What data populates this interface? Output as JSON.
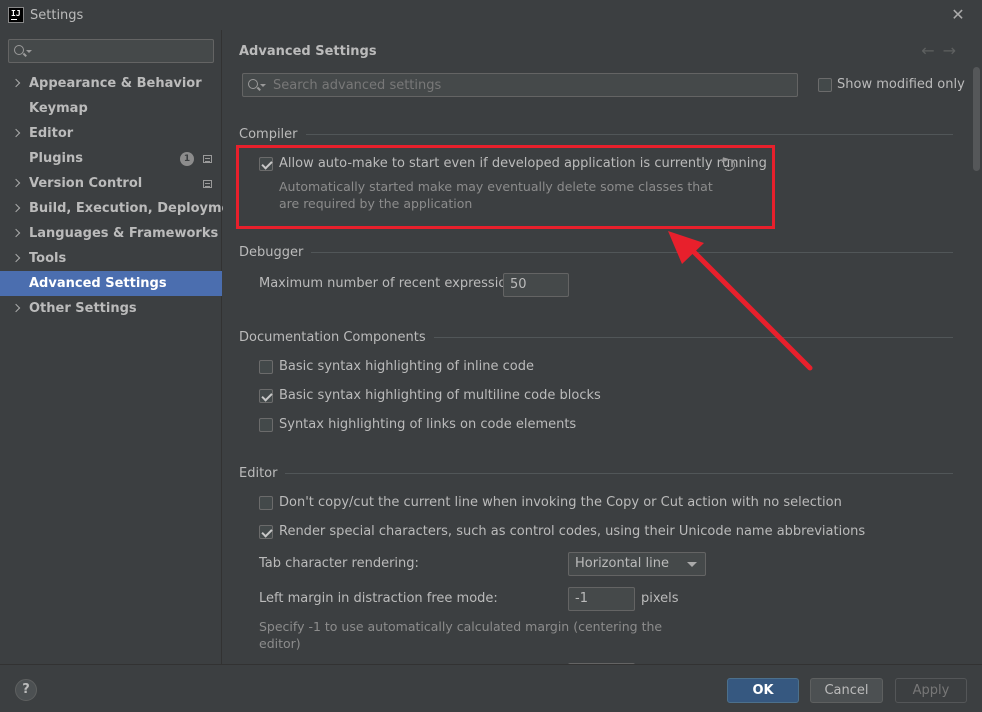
{
  "window": {
    "title": "Settings",
    "logo_text": "IJ"
  },
  "sidebar": {
    "search_placeholder": "",
    "items": [
      {
        "label": "Appearance & Behavior",
        "expandable": true
      },
      {
        "label": "Keymap",
        "expandable": false
      },
      {
        "label": "Editor",
        "expandable": true
      },
      {
        "label": "Plugins",
        "expandable": false,
        "badge": "1"
      },
      {
        "label": "Version Control",
        "expandable": true
      },
      {
        "label": "Build, Execution, Deployment",
        "expandable": true
      },
      {
        "label": "Languages & Frameworks",
        "expandable": true
      },
      {
        "label": "Tools",
        "expandable": true
      },
      {
        "label": "Advanced Settings",
        "expandable": false,
        "selected": true
      },
      {
        "label": "Other Settings",
        "expandable": true
      }
    ]
  },
  "main": {
    "title": "Advanced Settings",
    "search_placeholder": "Search advanced settings",
    "show_modified_label": "Show modified only",
    "compiler": {
      "heading": "Compiler",
      "auto_make_label": "Allow auto-make to start even if developed application is currently running",
      "auto_make_desc_1": "Automatically started make may eventually delete some classes that",
      "auto_make_desc_2": "are required by the application"
    },
    "debugger": {
      "heading": "Debugger",
      "recent_expr_label": "Maximum number of recent expressions:",
      "recent_expr_value": "50"
    },
    "documentation": {
      "heading": "Documentation Components",
      "inline_code_label": "Basic syntax highlighting of inline code",
      "multiline_code_label": "Basic syntax highlighting of multiline code blocks",
      "links_label": "Syntax highlighting of links on code elements"
    },
    "editor": {
      "heading": "Editor",
      "copy_cut_label": "Don't copy/cut the current line when invoking the Copy or Cut action with no selection",
      "render_special_label": "Render special characters, such as control codes, using their Unicode name abbreviations",
      "tab_rendering_label": "Tab character rendering:",
      "tab_rendering_value": "Horizontal line",
      "left_margin_label": "Left margin in distraction free mode:",
      "left_margin_value": "-1",
      "left_margin_unit": "pixels",
      "left_margin_desc_1": "Specify -1 to use automatically calculated margin (centering the",
      "left_margin_desc_2": "editor)"
    }
  },
  "footer": {
    "help_label": "?",
    "ok_label": "OK",
    "cancel_label": "Cancel",
    "apply_label": "Apply"
  },
  "colors": {
    "accent": "#4b6eaf",
    "highlight": "#e8202c"
  }
}
